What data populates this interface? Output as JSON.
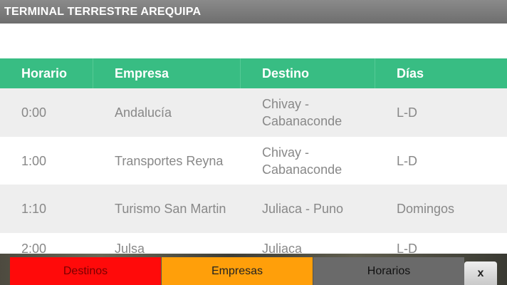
{
  "app": {
    "title": "TERMINAL TERRESTRE AREQUIPA"
  },
  "table": {
    "headers": [
      "Horario",
      "Empresa",
      "Destino",
      "Días"
    ],
    "rows": [
      {
        "horario": "0:00",
        "empresa": "Andalucía",
        "destino": "Chivay - Cabanaconde",
        "dias": "L-D"
      },
      {
        "horario": "1:00",
        "empresa": "Transportes Reyna",
        "destino": "Chivay - Cabanaconde",
        "dias": "L-D"
      },
      {
        "horario": "1:10",
        "empresa": "Turismo San Martin",
        "destino": "Juliaca - Puno",
        "dias": "Domingos"
      },
      {
        "horario": "2:00",
        "empresa": "Julsa",
        "destino": "Juliaca",
        "dias": "L-D"
      }
    ]
  },
  "bottom_bar": {
    "destinos_label": "Destinos",
    "empresas_label": "Empresas",
    "horarios_label": "Horarios",
    "close_label": "x"
  },
  "colors": {
    "header_green": "#38bd83",
    "destinos_red": "#ff0a0a",
    "empresas_orange": "#ff9f0a",
    "horarios_gray": "#6a6a6a"
  }
}
